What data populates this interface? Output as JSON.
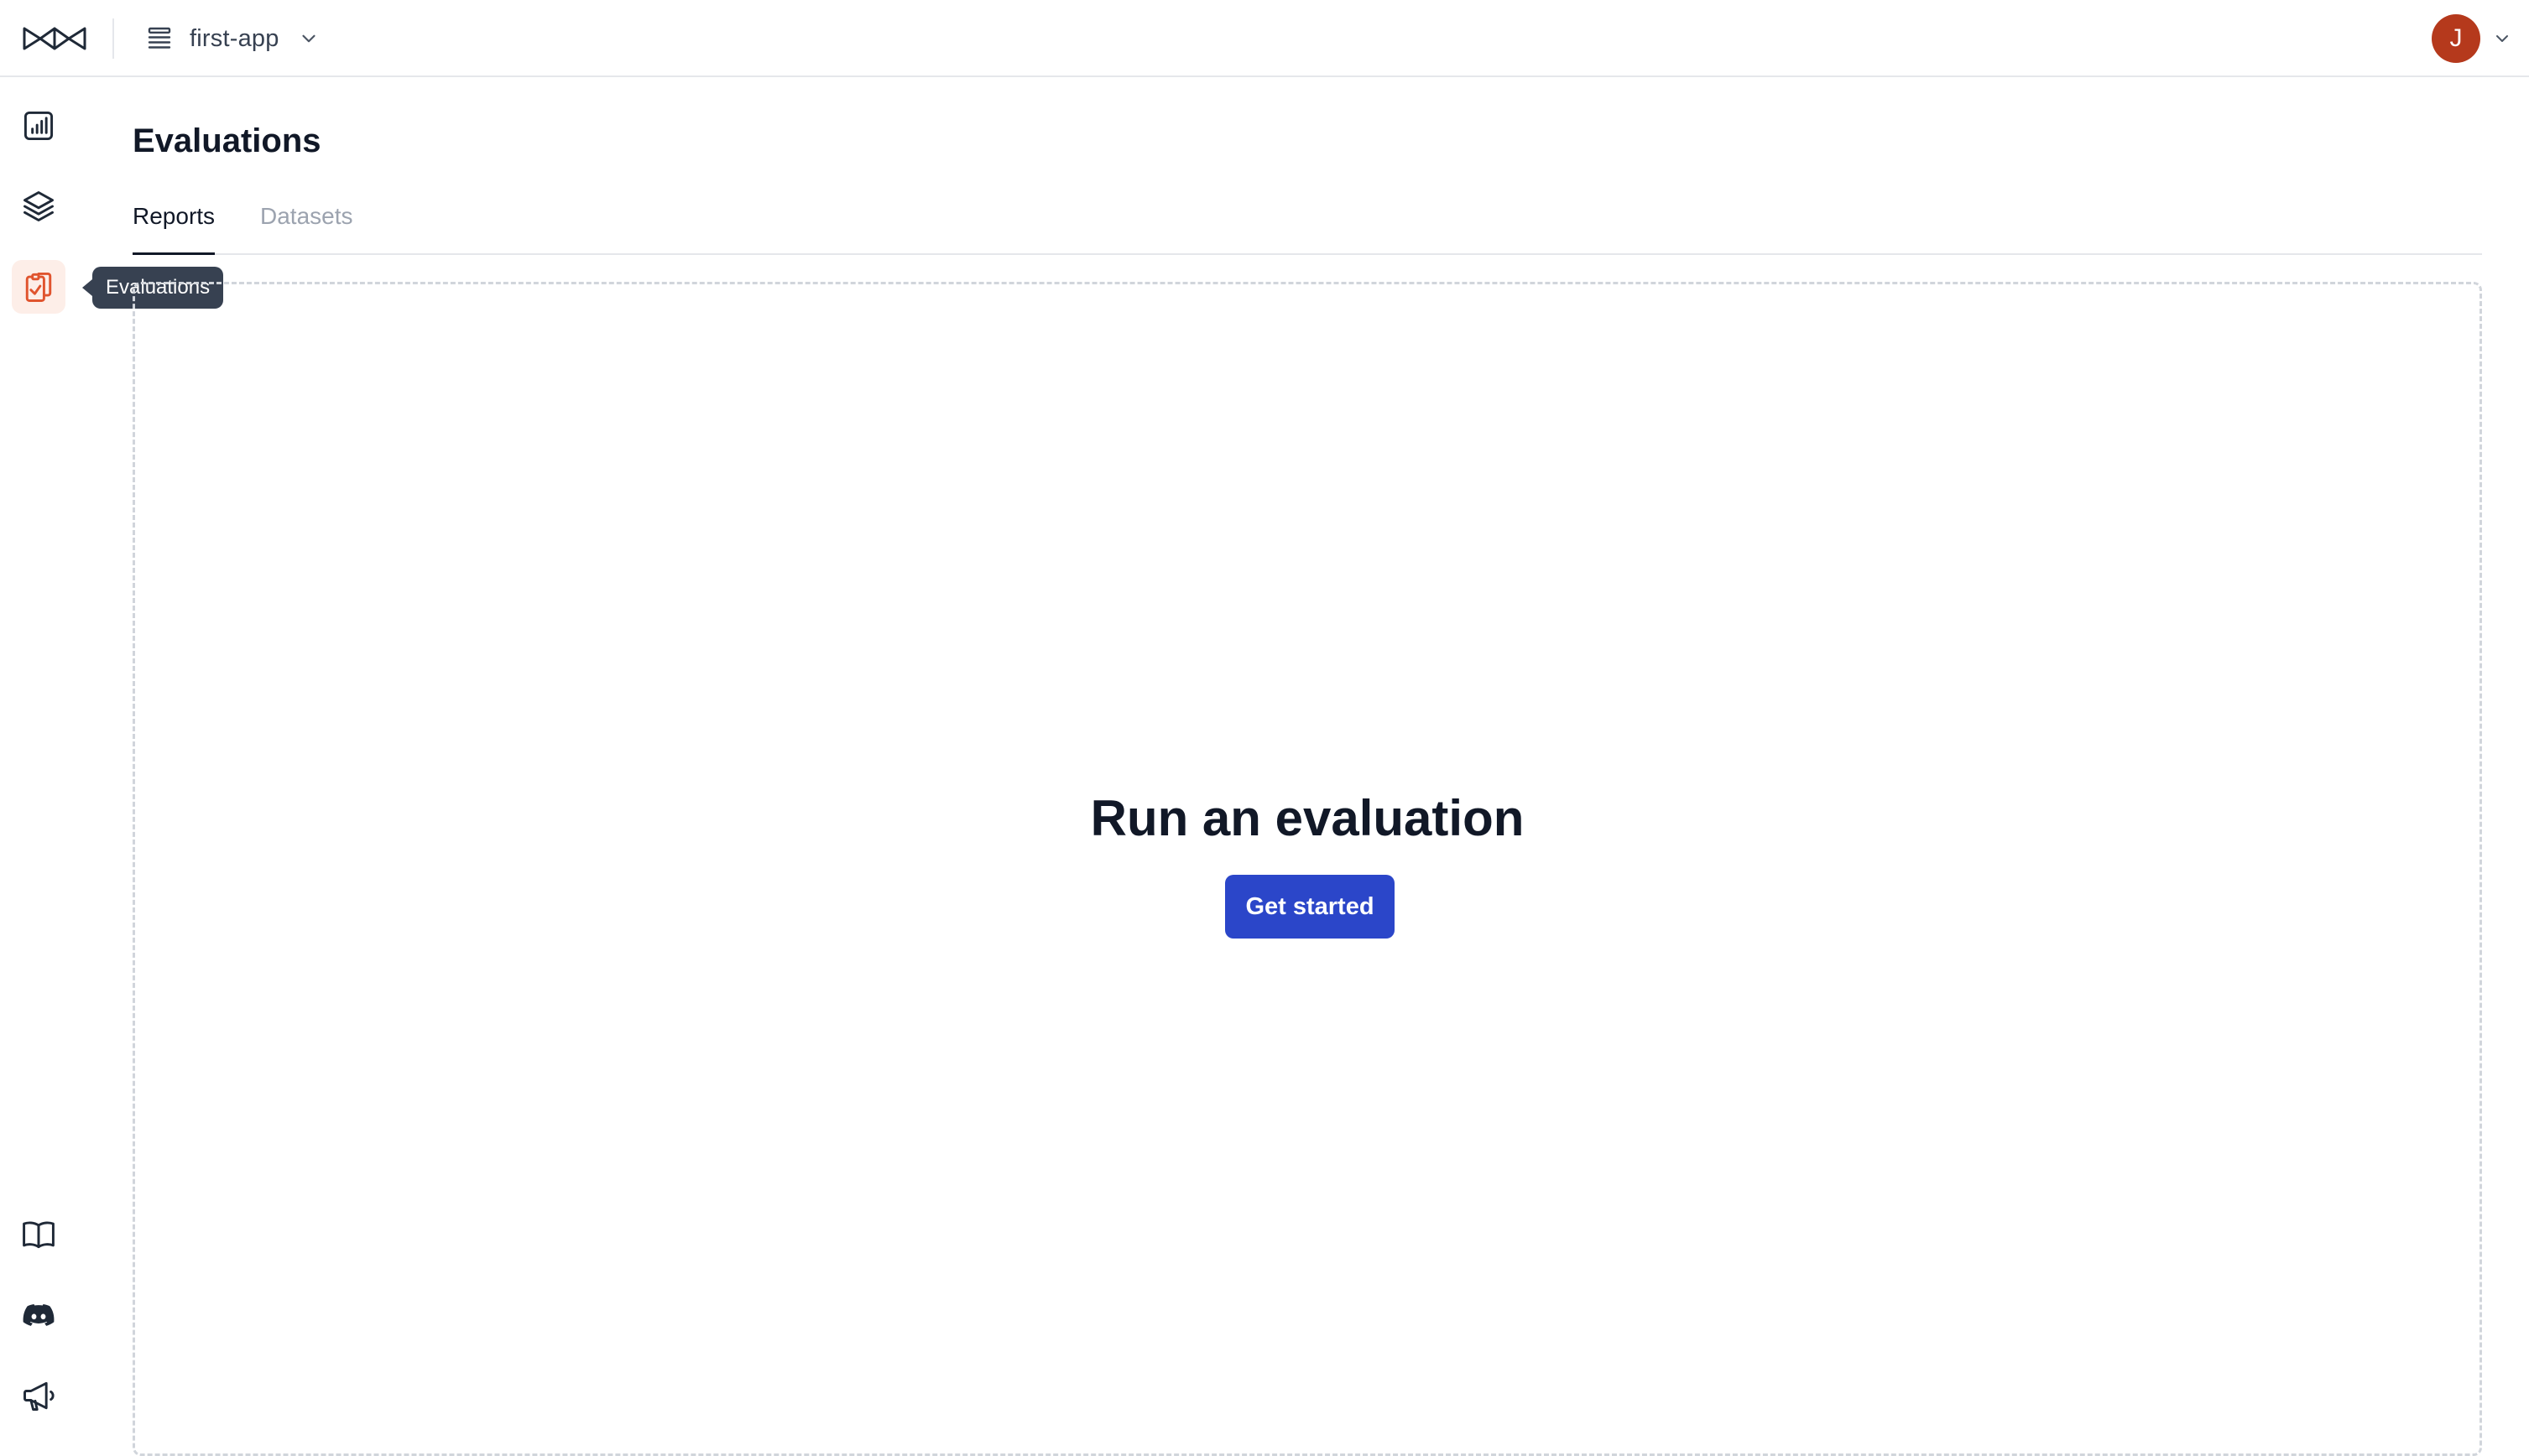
{
  "header": {
    "logo_icon": "brand-logo-icon",
    "project": {
      "name": "first-app",
      "icon": "stack-list-icon",
      "chevron": "chevron-down-icon"
    },
    "account": {
      "avatar_initial": "J",
      "avatar_color": "#b5391c",
      "chevron": "chevron-down-icon"
    }
  },
  "sidebar": {
    "top_items": [
      {
        "icon": "bar-chart-icon",
        "active": false
      },
      {
        "icon": "layers-icon",
        "active": false
      },
      {
        "icon": "clipboard-check-icon",
        "active": true,
        "tooltip": "Evaluations"
      }
    ],
    "bottom_items": [
      {
        "icon": "book-open-icon"
      },
      {
        "icon": "discord-icon"
      },
      {
        "icon": "megaphone-icon"
      }
    ],
    "active_color": "#e0542e",
    "active_bg": "#fdeee8"
  },
  "main": {
    "title": "Evaluations",
    "tabs": [
      {
        "label": "Reports",
        "active": true
      },
      {
        "label": "Datasets",
        "active": false
      }
    ],
    "empty_state": {
      "title": "Run an evaluation",
      "button_label": "Get started",
      "button_color": "#2b46c9"
    }
  }
}
